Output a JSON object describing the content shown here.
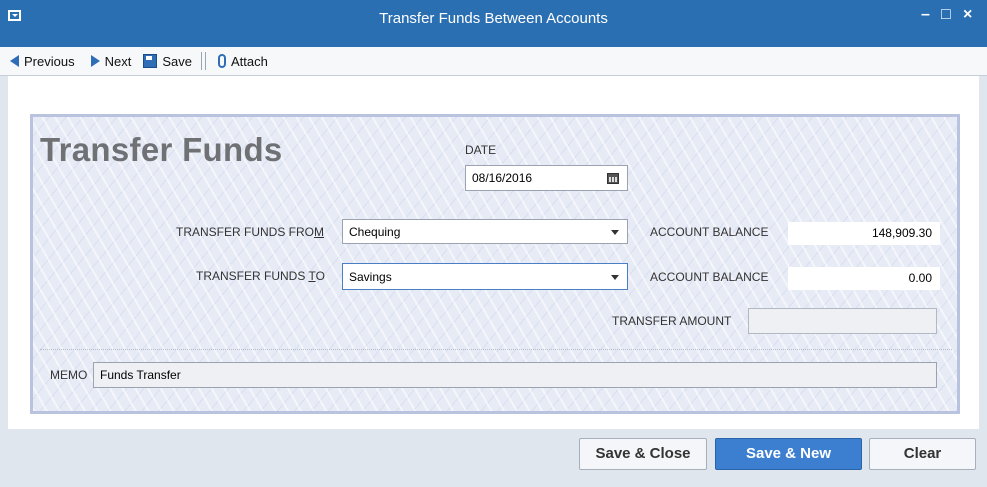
{
  "window": {
    "title": "Transfer Funds Between Accounts",
    "minimize": "–",
    "maximize": "□",
    "close": "×"
  },
  "toolbar": {
    "previous_label": "Previous",
    "next_label": "Next",
    "save_label": "Save",
    "attach_label": "Attach"
  },
  "form": {
    "title": "Transfer Funds",
    "date_label": "DATE",
    "date_value": "08/16/2016",
    "from_label": "TRANSFER FUNDS FROM",
    "from_value": "Chequing",
    "from_balance_label": "ACCOUNT BALANCE",
    "from_balance": "148,909.30",
    "to_label": "TRANSFER FUNDS TO",
    "to_value": "Savings",
    "to_balance_label": "ACCOUNT BALANCE",
    "to_balance": "0.00",
    "amount_label": "TRANSFER AMOUNT",
    "amount_value": "",
    "memo_label": "MEMO",
    "memo_value": "Funds Transfer"
  },
  "buttons": {
    "save_close": "Save & Close",
    "save_new": "Save & New",
    "clear": "Clear"
  },
  "icons": {
    "previous": "arrow-left-icon",
    "next": "arrow-right-icon",
    "save": "floppy-disk-icon",
    "attach": "paperclip-icon",
    "date": "calendar-icon"
  },
  "colors": {
    "titlebar": "#2b6fb3",
    "primary_button": "#3c7fd1",
    "panel": "#e7ebf6"
  }
}
